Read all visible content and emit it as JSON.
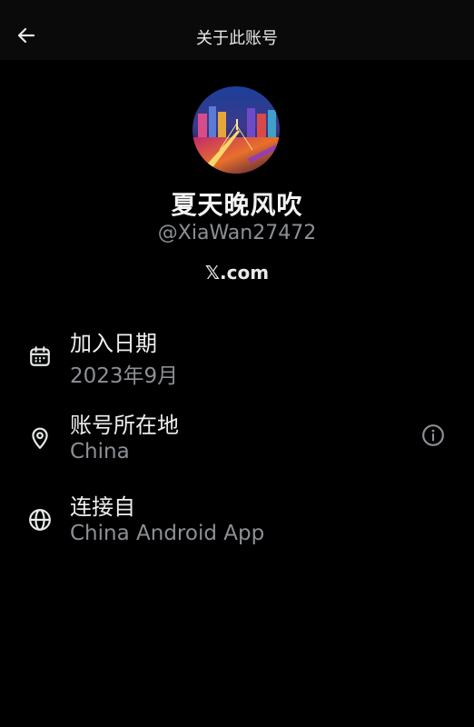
{
  "header": {
    "title": "关于此账号",
    "back_icon": "arrow-left-icon"
  },
  "profile": {
    "display_name": "夏天晚风吹",
    "handle": "@XiaWan27472",
    "domain": "𝕏.com",
    "avatar_icon": "avatar-night-city-photo"
  },
  "details": [
    {
      "icon": "calendar-icon",
      "label": "加入日期",
      "value": "2023年9月"
    },
    {
      "icon": "location-pin-icon",
      "label": "账号所在地",
      "value": "China"
    },
    {
      "icon": "globe-icon",
      "label": "连接自",
      "value": "China Android App"
    }
  ],
  "colors": {
    "background": "#000000",
    "header_bg": "#0a0a0a",
    "primary_text": "#e7e9ea",
    "secondary_text": "#8b9096"
  }
}
